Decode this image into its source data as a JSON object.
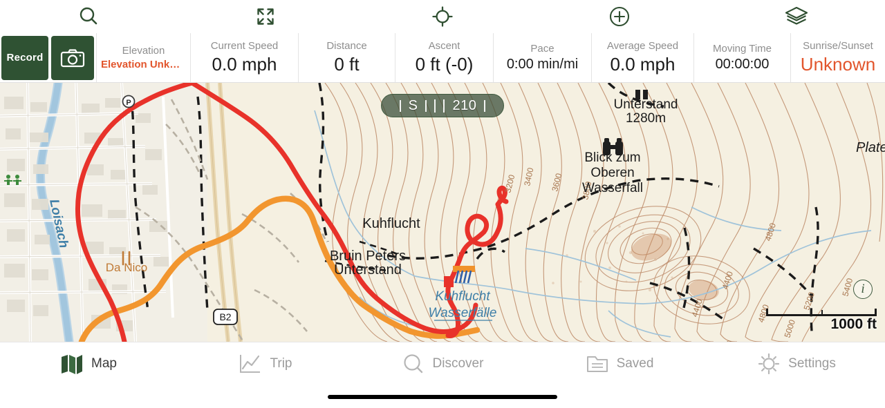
{
  "toolbar": {
    "items": [
      {
        "name": "search-icon",
        "label": "Search"
      },
      {
        "name": "expand-icon",
        "label": "Expand"
      },
      {
        "name": "locate-icon",
        "label": "Locate Me"
      },
      {
        "name": "add-icon",
        "label": "Add"
      },
      {
        "name": "layers-icon",
        "label": "Map Layers"
      }
    ]
  },
  "record": {
    "record_label": "Record",
    "camera_icon": "camera-icon",
    "button_color": "#2f5233"
  },
  "stats": [
    {
      "label": "Elevation",
      "value": "Elevation Unknown",
      "style": "warnsmall"
    },
    {
      "label": "Current Speed",
      "value": "0.0 mph",
      "style": "normal"
    },
    {
      "label": "Distance",
      "value": "0 ft",
      "style": "normal"
    },
    {
      "label": "Ascent",
      "value": "0 ft (-0)",
      "style": "normal"
    },
    {
      "label": "Pace",
      "value": "0:00 min/mi",
      "style": "small"
    },
    {
      "label": "Average Speed",
      "value": "0.0 mph",
      "style": "normal"
    },
    {
      "label": "Moving Time",
      "value": "00:00:00",
      "style": "small"
    },
    {
      "label": "Sunrise/Sunset",
      "value": "Unknown",
      "style": "warn"
    }
  ],
  "map": {
    "compass": {
      "direction": "S",
      "bearing": "210"
    },
    "scale": {
      "label": "1000 ft"
    },
    "info_button": "i",
    "labels": [
      {
        "text": "Loisach",
        "kind": "river"
      },
      {
        "text": "Da Nico",
        "kind": "poi-restaurant"
      },
      {
        "text": "B2",
        "kind": "road-shield"
      },
      {
        "text": "Kuhflucht",
        "kind": "place"
      },
      {
        "text": "Bruin Peters",
        "kind": "place"
      },
      {
        "text": "Unterstand",
        "kind": "place"
      },
      {
        "text": "Kuhflucht",
        "kind": "water-feature"
      },
      {
        "text": "Wasserfälle",
        "kind": "water-feature"
      },
      {
        "text": "Unterstand",
        "kind": "place"
      },
      {
        "text": "1280m",
        "kind": "elevation"
      },
      {
        "text": "Blick zum",
        "kind": "viewpoint"
      },
      {
        "text": "Oberen",
        "kind": "viewpoint"
      },
      {
        "text": "Wasserfall",
        "kind": "viewpoint"
      },
      {
        "text": "Plate",
        "kind": "place"
      }
    ],
    "contours": [
      "3200",
      "3400",
      "3600",
      "3800",
      "4400",
      "4600",
      "4800",
      "5000",
      "5200",
      "5400"
    ],
    "colors": {
      "background": "#f7f2e4",
      "track_red": "#e8322a",
      "track_orange": "#f0922b",
      "river_blue": "#a8c8dd",
      "contour": "#b98a6a"
    }
  },
  "tabbar": {
    "tabs": [
      {
        "label": "Map",
        "icon": "map-icon",
        "active": true
      },
      {
        "label": "Trip",
        "icon": "chart-icon",
        "active": false
      },
      {
        "label": "Discover",
        "icon": "search-icon",
        "active": false
      },
      {
        "label": "Saved",
        "icon": "folder-icon",
        "active": false
      },
      {
        "label": "Settings",
        "icon": "gear-icon",
        "active": false
      }
    ]
  }
}
